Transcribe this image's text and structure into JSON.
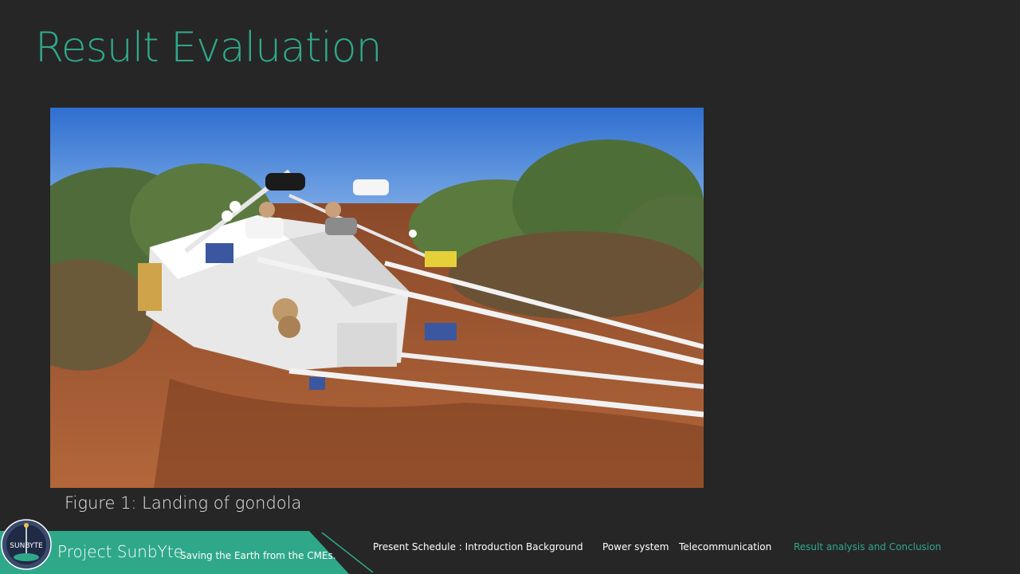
{
  "slide": {
    "title": "Result Evaluation",
    "caption": "Figure 1: Landing of gondola"
  },
  "photo": {
    "subject": "landed-balloon-gondola-in-desert"
  },
  "footer": {
    "project_name": "Project SunbYte",
    "tagline": "Saving the Earth from the CMEs.",
    "logo_text": "SUNBYTE",
    "accent_color": "#2fa88a",
    "nav": [
      {
        "label": "Present Schedule : Introduction",
        "active": false
      },
      {
        "label": "Background",
        "active": false
      },
      {
        "label": "Power system",
        "active": false
      },
      {
        "label": "Telecommunication",
        "active": false
      },
      {
        "label": "Result analysis and Conclusion",
        "active": true
      }
    ]
  }
}
